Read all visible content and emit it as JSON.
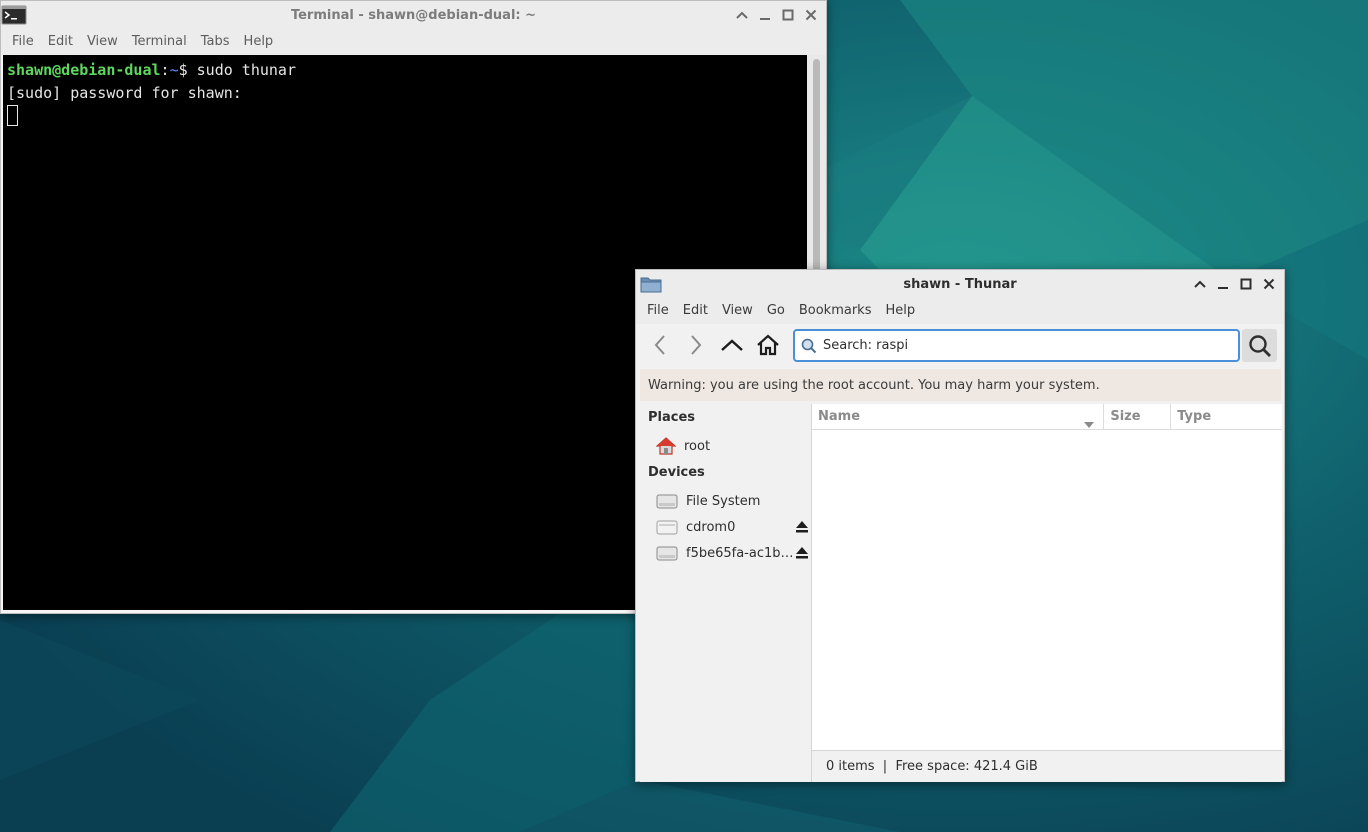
{
  "terminal": {
    "title": "Terminal - shawn@debian-dual: ~",
    "menu": [
      "File",
      "Edit",
      "View",
      "Terminal",
      "Tabs",
      "Help"
    ],
    "prompt_user": "shawn@debian-dual",
    "prompt_sep": ":",
    "prompt_dir": "~",
    "prompt_symbol": "$ ",
    "command": "sudo thunar",
    "output_line": "[sudo] password for shawn:"
  },
  "thunar": {
    "title": "shawn - Thunar",
    "menu": [
      "File",
      "Edit",
      "View",
      "Go",
      "Bookmarks",
      "Help"
    ],
    "search_value": "Search: raspi",
    "warning": "Warning: you are using the root account. You may harm your system.",
    "sidebar": {
      "places_heading": "Places",
      "places": [
        {
          "label": "root",
          "icon": "home-icon"
        }
      ],
      "devices_heading": "Devices",
      "devices": [
        {
          "label": "File System",
          "icon": "drive-icon",
          "eject": false
        },
        {
          "label": "cdrom0",
          "icon": "optical-drive-icon",
          "eject": true
        },
        {
          "label": "f5be65fa-ac1b…",
          "icon": "drive-icon",
          "eject": true
        }
      ]
    },
    "columns": [
      "Name",
      "Size",
      "Type"
    ],
    "status": "0 items  |  Free space: 421.4 GiB"
  },
  "colors": {
    "desktop_bg": "#0d4f5e",
    "accent": "#4a90d9",
    "prompt_green": "#5fd75f",
    "prompt_blue": "#5f87ff",
    "warning_bg": "#efe7e1"
  }
}
